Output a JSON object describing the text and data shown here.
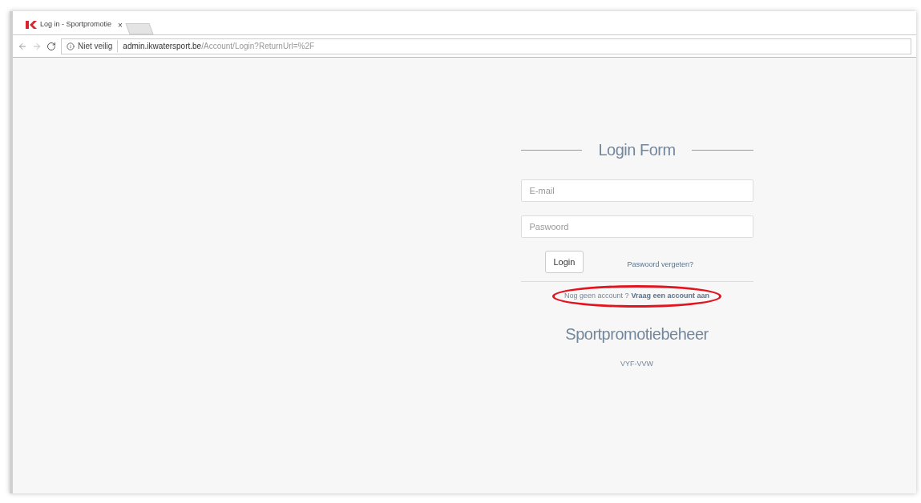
{
  "browser": {
    "tab_title": "Log in - Sportpromotie",
    "tab_close": "×",
    "security": "Niet veilig",
    "url_domain": "admin.ikwatersport.be",
    "url_path": "/Account/Login?ReturnUrl=%2F"
  },
  "form": {
    "title": "Login Form",
    "email_placeholder": "E-mail",
    "password_placeholder": "Paswoord",
    "login_button": "Login",
    "forgot_link": "Paswoord vergeten?",
    "no_account": "Nog geen account ?",
    "request_link": "Vraag een account aan",
    "app_name": "Sportpromotiebeheer",
    "footer": "VYF-VVW"
  }
}
